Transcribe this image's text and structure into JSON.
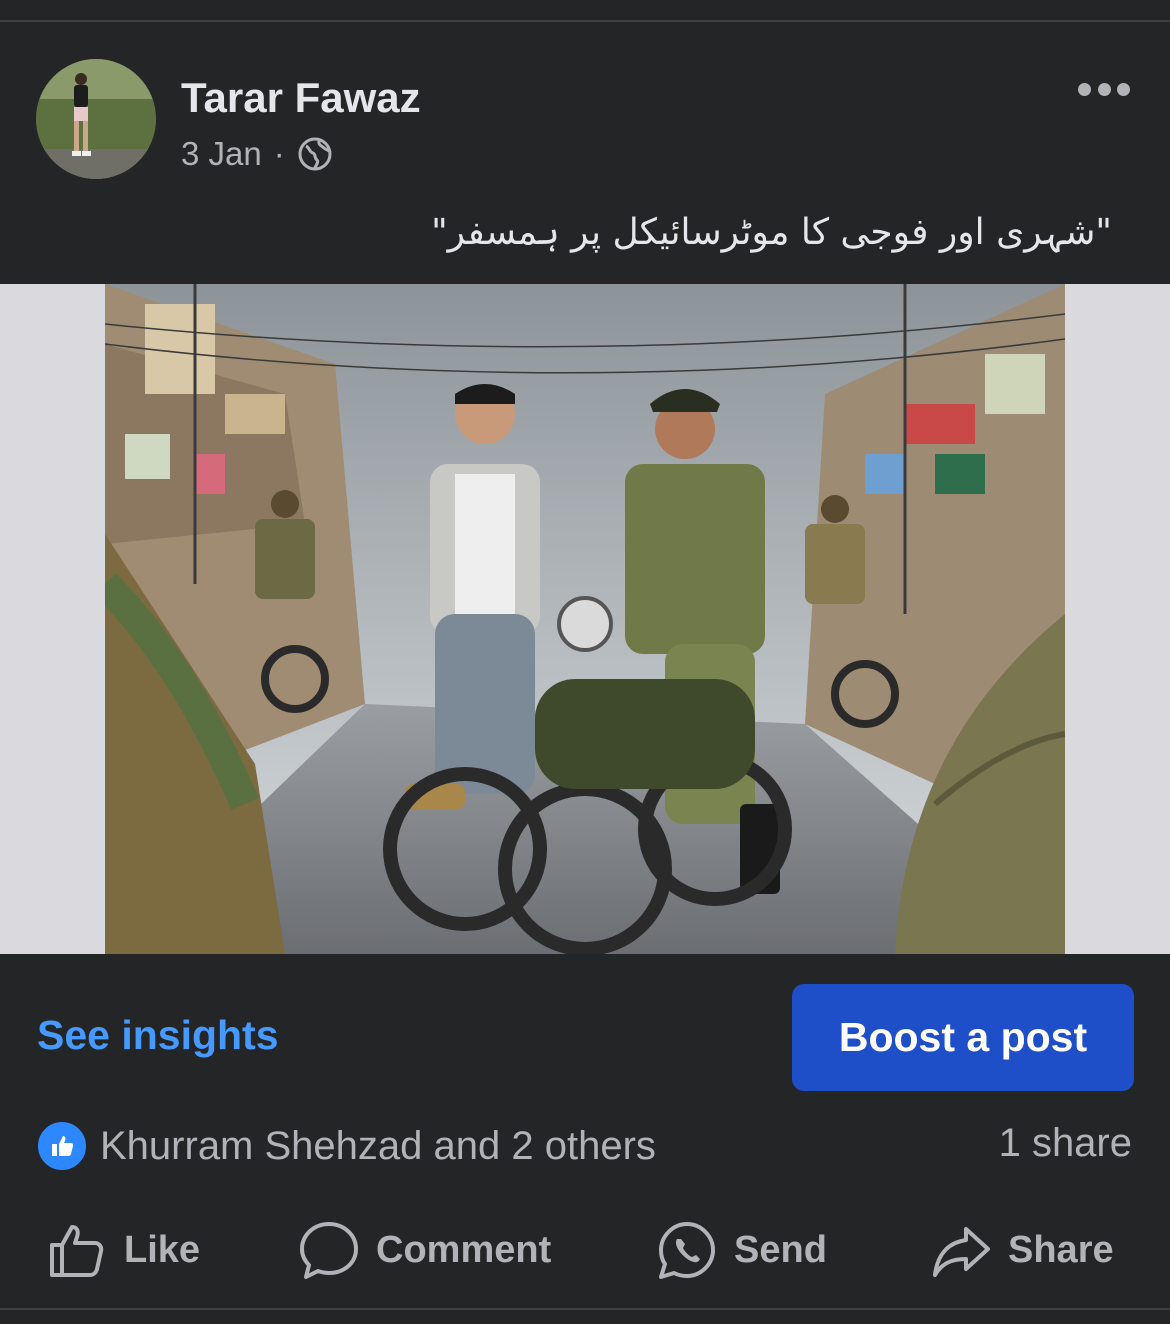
{
  "post": {
    "author": "Tarar Fawaz",
    "date": "3 Jan",
    "separator": "·",
    "privacy_icon": "globe-icon",
    "more_icon": "more-options-icon",
    "caption": "\"شہری اور فوجی کا موٹرسائیکل پر ہمسفر\""
  },
  "insights": {
    "link_label": "See insights"
  },
  "boost": {
    "button_label": "Boost a post",
    "color": "#1f4fc8"
  },
  "engagement": {
    "reaction_icon": "like-reaction-icon",
    "reactions_text": "Khurram Shehzad and 2 others",
    "shares_text": "1 share"
  },
  "actions": [
    {
      "label": "Like",
      "icon": "thumbs-up-icon"
    },
    {
      "label": "Comment",
      "icon": "comment-bubble-icon"
    },
    {
      "label": "Send",
      "icon": "whatsapp-icon"
    },
    {
      "label": "Share",
      "icon": "share-arrow-icon"
    }
  ],
  "colors": {
    "background": "#242526",
    "link": "#4599ff",
    "secondary_text": "#b0b3b8",
    "primary_text": "#e4e6eb"
  }
}
